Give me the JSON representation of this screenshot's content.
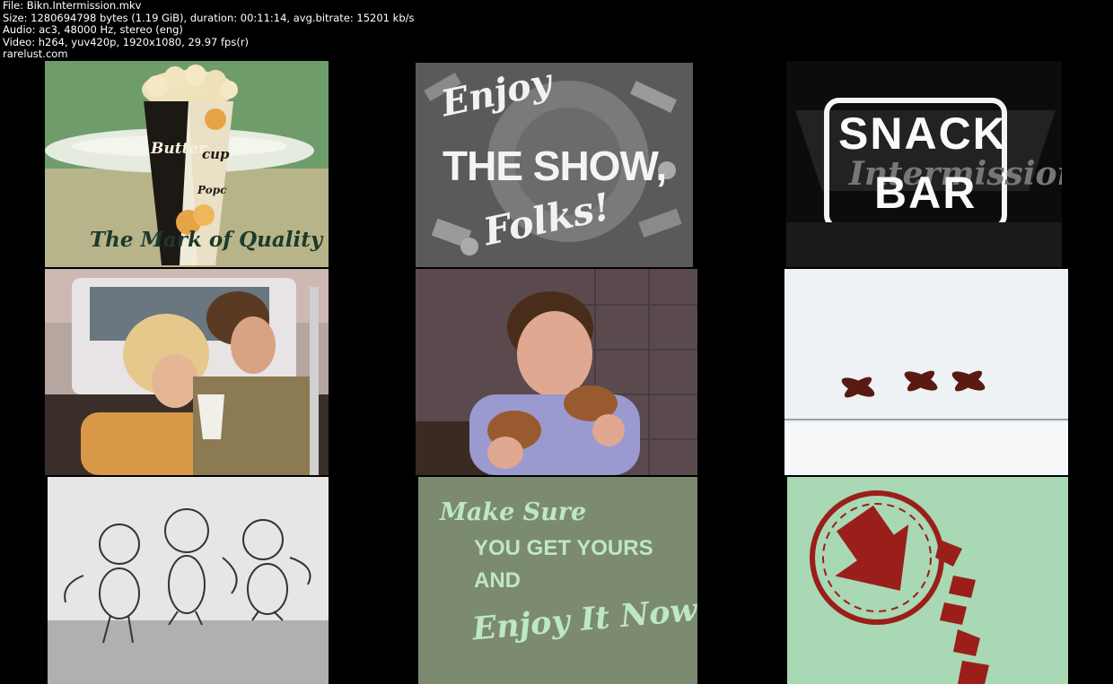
{
  "header": {
    "file_line": "File: Bikn.Intermission.mkv",
    "size_line": "Size: 1280694798 bytes (1.19 GiB), duration: 00:11:14, avg.bitrate: 15201 kb/s",
    "audio_line": "Audio: ac3, 48000 Hz, stereo (eng)",
    "video_line": "Video: h264, yuv420p, 1920x1080, 29.97 fps(r)",
    "site_line": "rarelust.com"
  },
  "frames": {
    "f1": {
      "cup_brand_1": "Butter",
      "cup_brand_2": "cup",
      "cup_word": "Popc",
      "tagline": "The Mark of Quality",
      "colors": {
        "bg": "#6a9a6a",
        "cup": "#1d1a16"
      }
    },
    "f2": {
      "enjoy": "Enjoy",
      "show": "THE SHOW,",
      "folks": "Folks!"
    },
    "f3": {
      "snack": "SNACK",
      "bar": "BAR",
      "script_behind": "Intermission"
    },
    "f4": {
      "cup_text": ""
    },
    "f5": {},
    "f6": {},
    "f7": {},
    "f8": {
      "line1": "Make Sure",
      "line2": "YOU GET YOURS",
      "line3": "AND",
      "line4": "Enjoy It Now!",
      "colors": {
        "bg": "#7a8a6e",
        "text": "#b8e8c0"
      }
    },
    "f9": {
      "colors": {
        "bg": "#a6d6b4",
        "arrow": "#9a1e1a"
      }
    }
  }
}
